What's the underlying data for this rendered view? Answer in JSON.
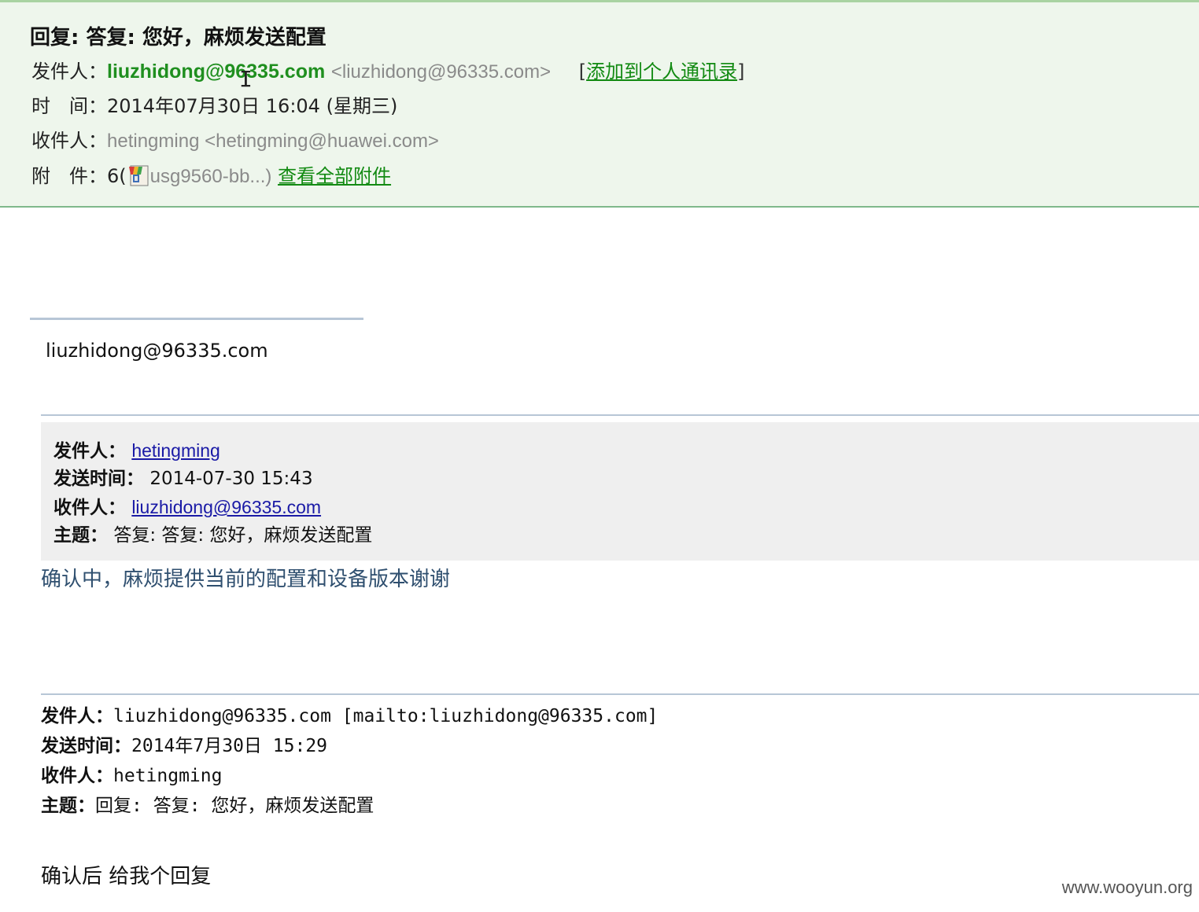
{
  "header": {
    "subject": "回复: 答复: 您好，麻烦发送配置",
    "from": {
      "label": "发件人：",
      "name": "liuzhidong@96335.com",
      "address": "<liuzhidong@96335.com>",
      "bracket_open": "[",
      "add_contact": "添加到个人通讯录",
      "bracket_close": "]"
    },
    "time": {
      "label": "时　间：",
      "value": "2014年07月30日 16:04 (星期三)"
    },
    "to": {
      "label": "收件人：",
      "value": "hetingming <hetingming@huawei.com>"
    },
    "attachments": {
      "label": "附　件：",
      "count_prefix": "6(",
      "file_name": "usg9560-bb...)",
      "view_all": "查看全部附件"
    }
  },
  "signature": {
    "text": "liuzhidong@96335.com"
  },
  "quote1": {
    "from_label": "发件人：",
    "from_value": "hetingming",
    "sent_label": "发送时间：",
    "sent_value": "2014-07-30 15:43",
    "to_label": "收件人：",
    "to_value": "liuzhidong@96335.com",
    "subject_label": "主题：",
    "subject_value": "答复: 答复: 您好，麻烦发送配置",
    "body": "确认中，麻烦提供当前的配置和设备版本谢谢"
  },
  "quote2": {
    "from_label": "发件人：",
    "from_value": "liuzhidong@96335.com [mailto:liuzhidong@96335.com]",
    "sent_label": "发送时间：",
    "sent_value": "2014年7月30日 15:29",
    "to_label": "收件人：",
    "to_value": "hetingming",
    "subject_label": "主题：",
    "subject_value": "回复: 答复: 您好，麻烦发送配置",
    "body": "确认后 给我个回复"
  },
  "watermark": "www.wooyun.org",
  "colors": {
    "header_bg": "#eef6ec",
    "sender_green": "#1f8f1f",
    "link_green": "#128a12",
    "link_blue": "#1a1aa6",
    "quote_bg": "#efefef"
  }
}
